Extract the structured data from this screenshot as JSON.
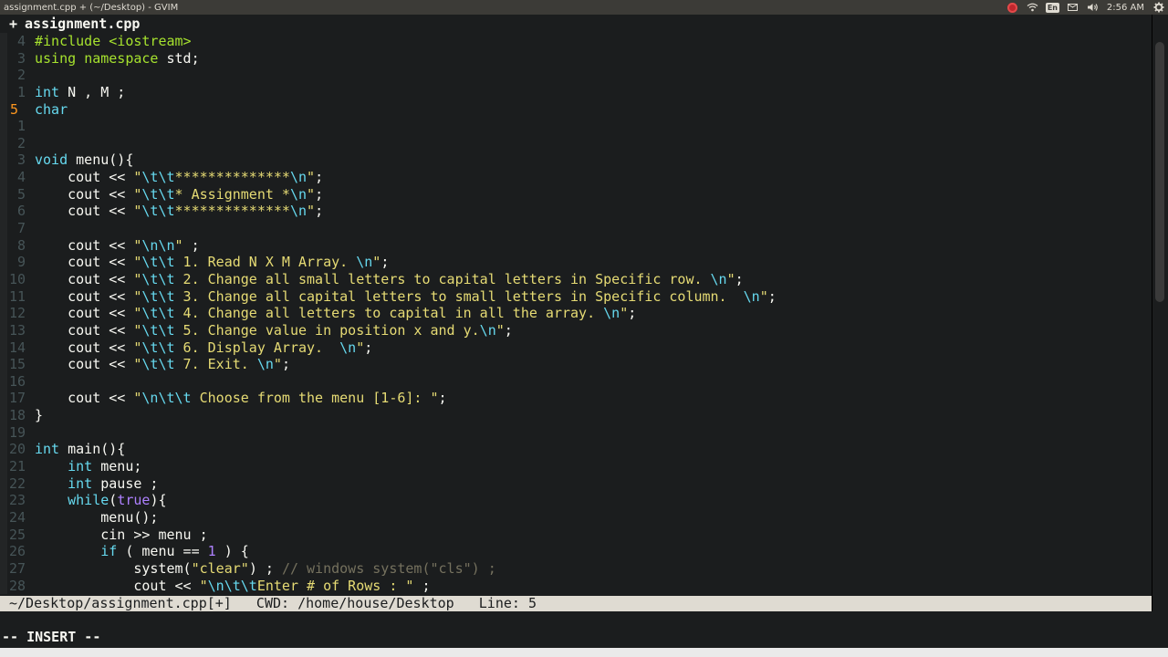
{
  "window": {
    "title": "assignment.cpp + (~/Desktop) - GVIM"
  },
  "tray": {
    "keyboard_layout": "En",
    "clock": "2:56 AM",
    "icons": [
      "record-icon",
      "wifi-icon",
      "keyboard-icon",
      "mail-icon",
      "volume-icon",
      "gear-icon"
    ]
  },
  "tabline": {
    "modified_marker": "+",
    "filename": "assignment.cpp"
  },
  "statusline": {
    "text": "~/Desktop/assignment.cpp[+]   CWD: /home/house/Desktop   Line: 5"
  },
  "mode": "-- INSERT --",
  "code": [
    {
      "ln": "4",
      "segs": [
        [
          "pp",
          "#include <iostream>"
        ]
      ]
    },
    {
      "ln": "3",
      "segs": [
        [
          "pp",
          "using"
        ],
        [
          "txt",
          " "
        ],
        [
          "pp",
          "namespace"
        ],
        [
          "txt",
          " std;"
        ]
      ]
    },
    {
      "ln": "2",
      "segs": []
    },
    {
      "ln": "1",
      "segs": [
        [
          "kw",
          "int"
        ],
        [
          "txt",
          " N , M ;"
        ]
      ]
    },
    {
      "ln": "5",
      "cur": true,
      "segs": [
        [
          "kw",
          "char"
        ]
      ]
    },
    {
      "ln": "1",
      "segs": []
    },
    {
      "ln": "2",
      "segs": []
    },
    {
      "ln": "3",
      "segs": [
        [
          "kw",
          "void"
        ],
        [
          "txt",
          " menu(){"
        ]
      ]
    },
    {
      "ln": "4",
      "segs": [
        [
          "txt",
          "    cout << "
        ],
        [
          "str",
          "\""
        ],
        [
          "esc",
          "\\t\\t"
        ],
        [
          "str",
          "**************"
        ],
        [
          "esc",
          "\\n"
        ],
        [
          "str",
          "\""
        ],
        [
          "txt",
          ";"
        ]
      ]
    },
    {
      "ln": "5",
      "segs": [
        [
          "txt",
          "    cout << "
        ],
        [
          "str",
          "\""
        ],
        [
          "esc",
          "\\t\\t"
        ],
        [
          "str",
          "* Assignment *"
        ],
        [
          "esc",
          "\\n"
        ],
        [
          "str",
          "\""
        ],
        [
          "txt",
          ";"
        ]
      ]
    },
    {
      "ln": "6",
      "segs": [
        [
          "txt",
          "    cout << "
        ],
        [
          "str",
          "\""
        ],
        [
          "esc",
          "\\t\\t"
        ],
        [
          "str",
          "**************"
        ],
        [
          "esc",
          "\\n"
        ],
        [
          "str",
          "\""
        ],
        [
          "txt",
          ";"
        ]
      ]
    },
    {
      "ln": "7",
      "segs": []
    },
    {
      "ln": "8",
      "segs": [
        [
          "txt",
          "    cout << "
        ],
        [
          "str",
          "\""
        ],
        [
          "esc",
          "\\n\\n"
        ],
        [
          "str",
          "\""
        ],
        [
          "txt",
          " ;"
        ]
      ]
    },
    {
      "ln": "9",
      "segs": [
        [
          "txt",
          "    cout << "
        ],
        [
          "str",
          "\""
        ],
        [
          "esc",
          "\\t\\t"
        ],
        [
          "str",
          " 1. Read N X M Array. "
        ],
        [
          "esc",
          "\\n"
        ],
        [
          "str",
          "\""
        ],
        [
          "txt",
          ";"
        ]
      ]
    },
    {
      "ln": "10",
      "segs": [
        [
          "txt",
          "    cout << "
        ],
        [
          "str",
          "\""
        ],
        [
          "esc",
          "\\t\\t"
        ],
        [
          "str",
          " 2. Change all small letters to capital letters in Specific row. "
        ],
        [
          "esc",
          "\\n"
        ],
        [
          "str",
          "\""
        ],
        [
          "txt",
          ";"
        ]
      ]
    },
    {
      "ln": "11",
      "segs": [
        [
          "txt",
          "    cout << "
        ],
        [
          "str",
          "\""
        ],
        [
          "esc",
          "\\t\\t"
        ],
        [
          "str",
          " 3. Change all capital letters to small letters in Specific column.  "
        ],
        [
          "esc",
          "\\n"
        ],
        [
          "str",
          "\""
        ],
        [
          "txt",
          ";"
        ]
      ]
    },
    {
      "ln": "12",
      "segs": [
        [
          "txt",
          "    cout << "
        ],
        [
          "str",
          "\""
        ],
        [
          "esc",
          "\\t\\t"
        ],
        [
          "str",
          " 4. Change all letters to capital in all the array. "
        ],
        [
          "esc",
          "\\n"
        ],
        [
          "str",
          "\""
        ],
        [
          "txt",
          ";"
        ]
      ]
    },
    {
      "ln": "13",
      "segs": [
        [
          "txt",
          "    cout << "
        ],
        [
          "str",
          "\""
        ],
        [
          "esc",
          "\\t\\t"
        ],
        [
          "str",
          " 5. Change value in position x and y."
        ],
        [
          "esc",
          "\\n"
        ],
        [
          "str",
          "\""
        ],
        [
          "txt",
          ";"
        ]
      ]
    },
    {
      "ln": "14",
      "segs": [
        [
          "txt",
          "    cout << "
        ],
        [
          "str",
          "\""
        ],
        [
          "esc",
          "\\t\\t"
        ],
        [
          "str",
          " 6. Display Array.  "
        ],
        [
          "esc",
          "\\n"
        ],
        [
          "str",
          "\""
        ],
        [
          "txt",
          ";"
        ]
      ]
    },
    {
      "ln": "15",
      "segs": [
        [
          "txt",
          "    cout << "
        ],
        [
          "str",
          "\""
        ],
        [
          "esc",
          "\\t\\t"
        ],
        [
          "str",
          " 7. Exit. "
        ],
        [
          "esc",
          "\\n"
        ],
        [
          "str",
          "\""
        ],
        [
          "txt",
          ";"
        ]
      ]
    },
    {
      "ln": "16",
      "segs": []
    },
    {
      "ln": "17",
      "segs": [
        [
          "txt",
          "    cout << "
        ],
        [
          "str",
          "\""
        ],
        [
          "esc",
          "\\n\\t\\t"
        ],
        [
          "str",
          " Choose from the menu [1-6]: \""
        ],
        [
          "txt",
          ";"
        ]
      ]
    },
    {
      "ln": "18",
      "segs": [
        [
          "txt",
          "}"
        ]
      ]
    },
    {
      "ln": "19",
      "segs": []
    },
    {
      "ln": "20",
      "segs": [
        [
          "kw",
          "int"
        ],
        [
          "txt",
          " main(){"
        ]
      ]
    },
    {
      "ln": "21",
      "segs": [
        [
          "txt",
          "    "
        ],
        [
          "kw",
          "int"
        ],
        [
          "txt",
          " menu;"
        ]
      ]
    },
    {
      "ln": "22",
      "segs": [
        [
          "txt",
          "    "
        ],
        [
          "kw",
          "int"
        ],
        [
          "txt",
          " pause ;"
        ]
      ]
    },
    {
      "ln": "23",
      "segs": [
        [
          "txt",
          "    "
        ],
        [
          "kw",
          "while"
        ],
        [
          "txt",
          "("
        ],
        [
          "num",
          "true"
        ],
        [
          "txt",
          "){"
        ]
      ]
    },
    {
      "ln": "24",
      "segs": [
        [
          "txt",
          "        menu();"
        ]
      ]
    },
    {
      "ln": "25",
      "segs": [
        [
          "txt",
          "        cin >> menu ;"
        ]
      ]
    },
    {
      "ln": "26",
      "segs": [
        [
          "txt",
          "        "
        ],
        [
          "kw",
          "if"
        ],
        [
          "txt",
          " ( menu == "
        ],
        [
          "num",
          "1"
        ],
        [
          "txt",
          " ) {"
        ]
      ]
    },
    {
      "ln": "27",
      "segs": [
        [
          "txt",
          "            system("
        ],
        [
          "str",
          "\"clear\""
        ],
        [
          "txt",
          ") ; "
        ],
        [
          "cmt",
          "// windows system(\"cls\") ;"
        ]
      ]
    },
    {
      "ln": "28",
      "segs": [
        [
          "txt",
          "            cout << "
        ],
        [
          "str",
          "\""
        ],
        [
          "esc",
          "\\n\\t\\t"
        ],
        [
          "str",
          "Enter # of Rows : \""
        ],
        [
          "txt",
          " ;"
        ]
      ]
    }
  ]
}
